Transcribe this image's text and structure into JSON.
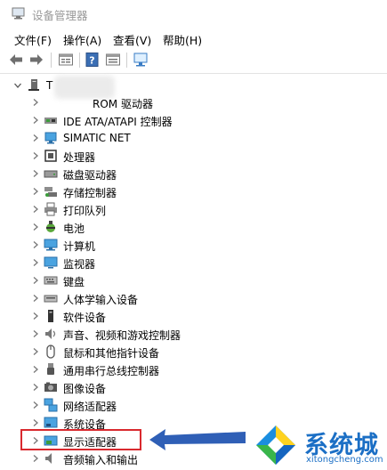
{
  "window": {
    "title": "设备管理器",
    "app_icon": "device-manager-icon"
  },
  "menu": [
    "文件(F)",
    "操作(A)",
    "查看(V)",
    "帮助(H)"
  ],
  "toolbar": {
    "buttons": [
      "back-arrow-icon",
      "forward-arrow-icon",
      "properties-icon",
      "help-icon",
      "update-driver-icon",
      "scan-hardware-icon"
    ]
  },
  "tree": {
    "root_label": "T",
    "items": [
      {
        "label": "ROM 驱动器",
        "icon": "dvd-drive-icon"
      },
      {
        "label": "IDE ATA/ATAPI 控制器",
        "icon": "ide-controller-icon"
      },
      {
        "label": "SIMATIC NET",
        "icon": "network-icon"
      },
      {
        "label": "处理器",
        "icon": "processor-icon"
      },
      {
        "label": "磁盘驱动器",
        "icon": "disk-drive-icon"
      },
      {
        "label": "存储控制器",
        "icon": "storage-controller-icon"
      },
      {
        "label": "打印队列",
        "icon": "printer-icon"
      },
      {
        "label": "电池",
        "icon": "battery-icon"
      },
      {
        "label": "计算机",
        "icon": "computer-icon"
      },
      {
        "label": "监视器",
        "icon": "monitor-icon"
      },
      {
        "label": "键盘",
        "icon": "keyboard-icon"
      },
      {
        "label": "人体学输入设备",
        "icon": "hid-icon"
      },
      {
        "label": "软件设备",
        "icon": "software-device-icon"
      },
      {
        "label": "声音、视频和游戏控制器",
        "icon": "speaker-icon"
      },
      {
        "label": "鼠标和其他指针设备",
        "icon": "mouse-icon"
      },
      {
        "label": "通用串行总线控制器",
        "icon": "usb-icon"
      },
      {
        "label": "图像设备",
        "icon": "camera-icon"
      },
      {
        "label": "网络适配器",
        "icon": "network-adapter-icon"
      },
      {
        "label": "系统设备",
        "icon": "system-device-icon"
      },
      {
        "label": "显示适配器",
        "icon": "display-adapter-icon"
      },
      {
        "label": "音频输入和输出",
        "icon": "audio-io-icon"
      }
    ]
  },
  "annotation": {
    "color": "#d9292e",
    "arrow_color": "#2f5fb6"
  },
  "watermark": {
    "brand": "系统城",
    "url": "xitongcheng.com",
    "color": "#1b6fc5"
  }
}
